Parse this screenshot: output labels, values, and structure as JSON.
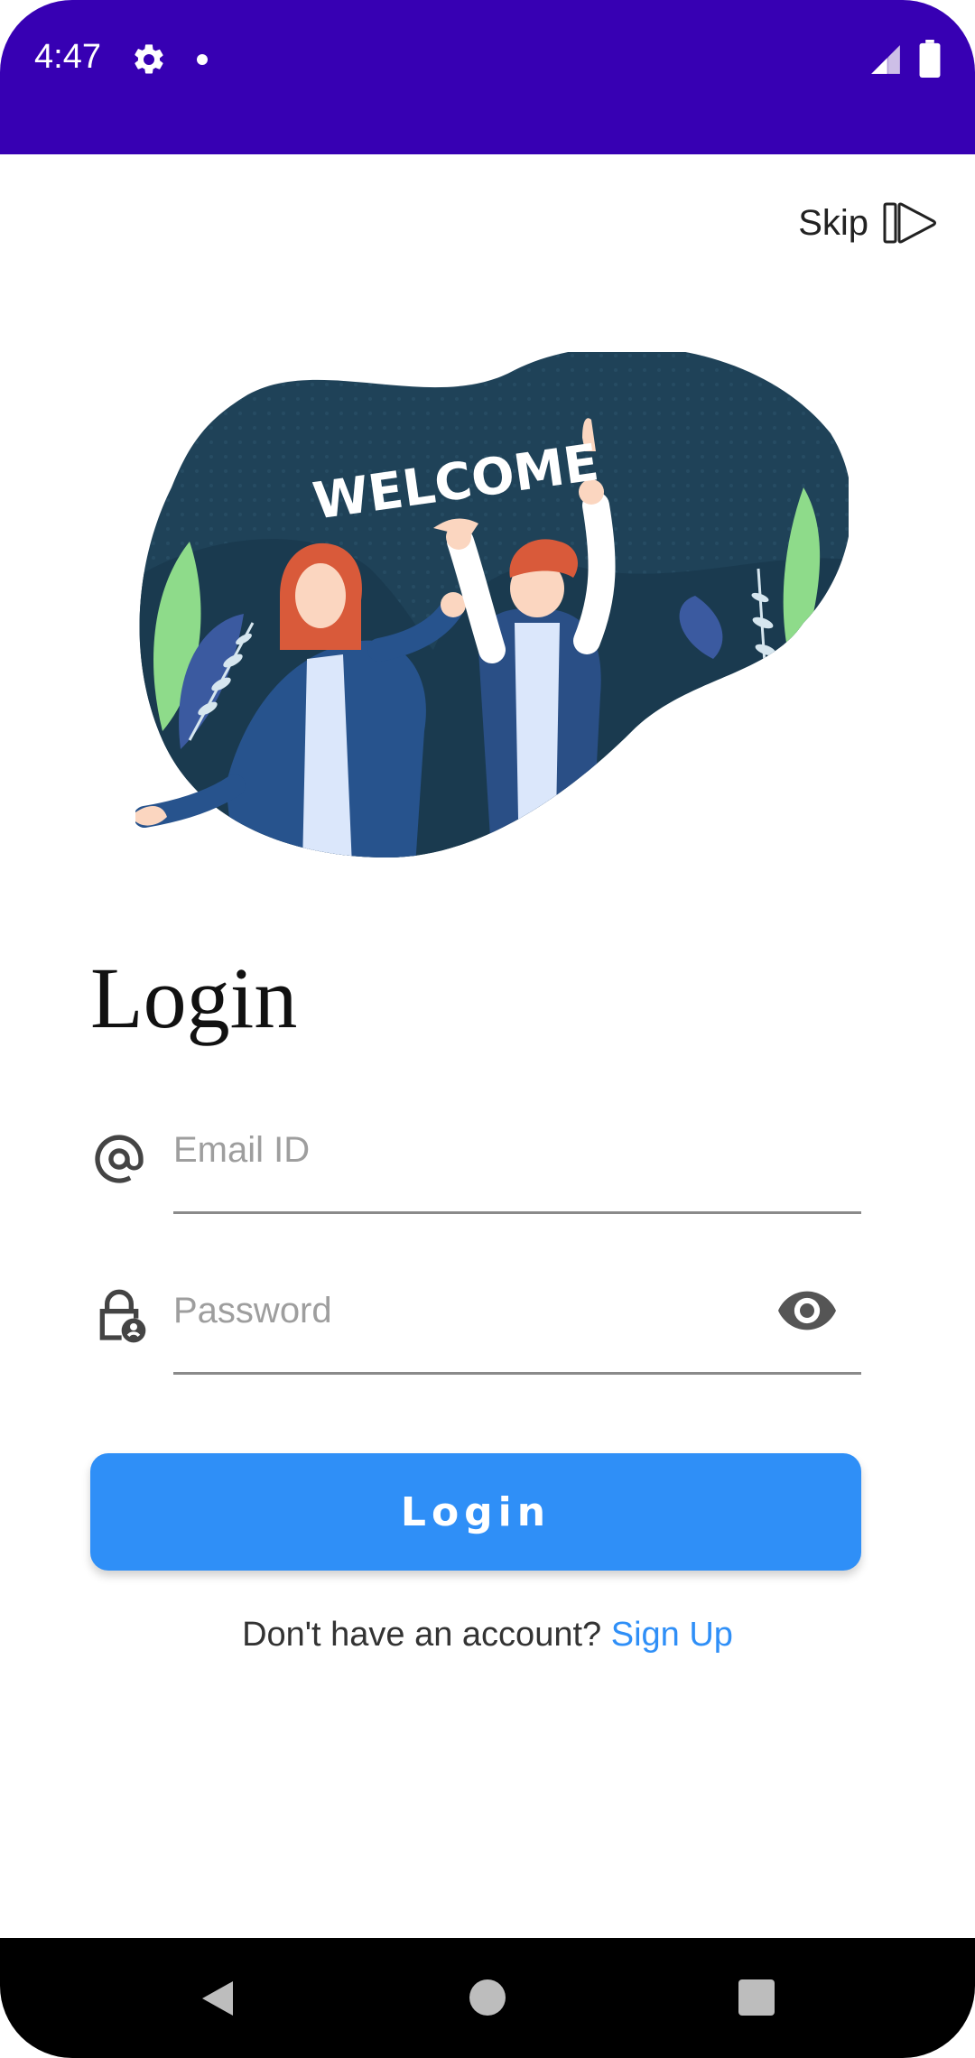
{
  "status_bar": {
    "time": "4:47",
    "background_color": "#3700b3",
    "icons": [
      "gear-icon",
      "notification-dot-icon",
      "signal-icon",
      "battery-icon"
    ]
  },
  "skip": {
    "label": "Skip",
    "icon": "skip-forward-icon"
  },
  "illustration": {
    "banner_text": "WELCOME"
  },
  "login": {
    "heading": "Login",
    "email_placeholder": "Email ID",
    "email_value": "",
    "email_icon": "at-icon",
    "password_placeholder": "Password",
    "password_value": "",
    "password_icon": "lock-person-icon",
    "visibility_icon": "eye-icon",
    "button_label": "Login",
    "button_color": "#2f8ff7"
  },
  "signup": {
    "prompt": "Don't have an account? ",
    "link_label": "Sign Up",
    "link_color": "#2f8ff7"
  },
  "nav_bar": {
    "buttons": [
      "back-icon",
      "home-icon",
      "recents-icon"
    ]
  }
}
